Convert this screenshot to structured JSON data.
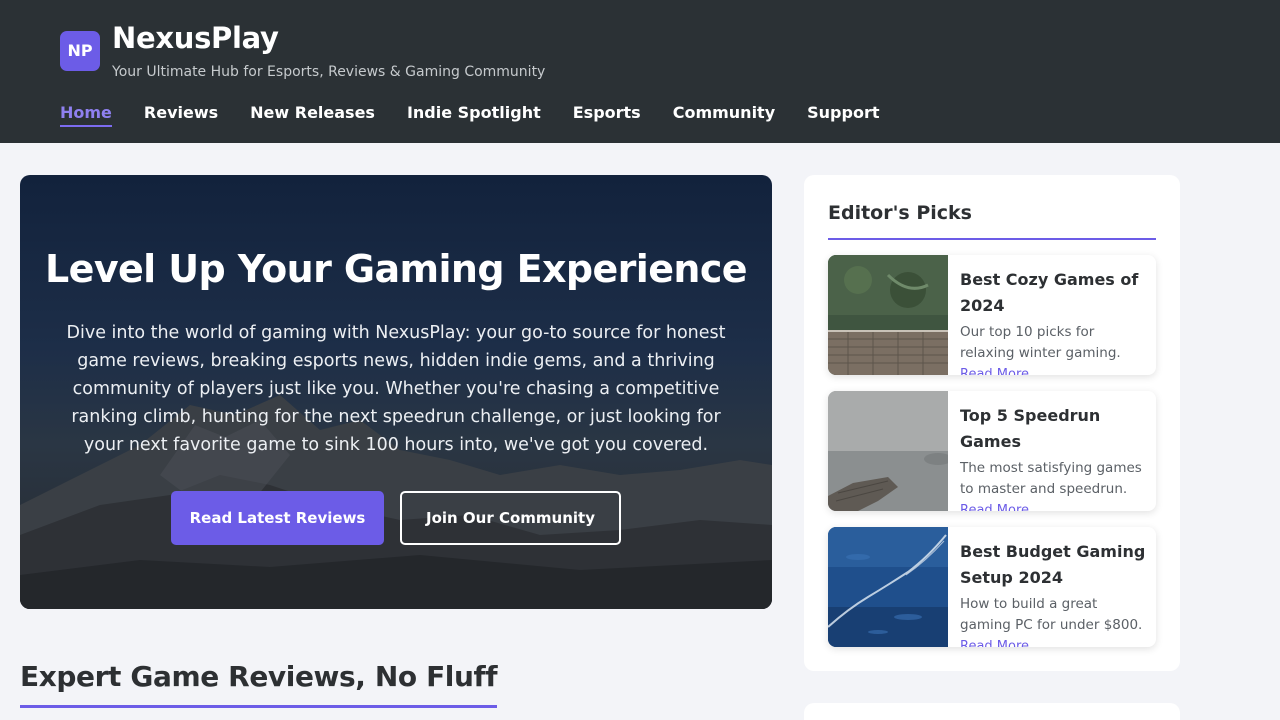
{
  "site": {
    "logo_text": "NP",
    "name": "NexusPlay",
    "tagline": "Your Ultimate Hub for Esports, Reviews & Gaming Community"
  },
  "nav": {
    "items": [
      {
        "label": "Home",
        "active": true
      },
      {
        "label": "Reviews"
      },
      {
        "label": "New Releases"
      },
      {
        "label": "Indie Spotlight"
      },
      {
        "label": "Esports"
      },
      {
        "label": "Community"
      },
      {
        "label": "Support"
      }
    ]
  },
  "hero": {
    "title": "Level Up Your Gaming Experience",
    "text": "Dive into the world of gaming with NexusPlay: your go-to source for honest game reviews, breaking esports news, hidden indie gems, and a thriving community of players just like you. Whether you're chasing a competitive ranking climb, hunting for the next speedrun challenge, or just looking for your next favorite game to sink 100 hours into, we've got you covered.",
    "primary_button": "Read Latest Reviews",
    "secondary_button": "Join Our Community"
  },
  "section": {
    "title": "Expert Game Reviews, No Fluff"
  },
  "editors_picks": {
    "title": "Editor's Picks",
    "items": [
      {
        "title": "Best Cozy Games of 2024",
        "desc": "Our top 10 picks for relaxing winter gaming.",
        "more": "Read More"
      },
      {
        "title": "Top 5 Speedrun Games",
        "desc": "The most satisfying games to master and speedrun.",
        "more": "Read More"
      },
      {
        "title": "Best Budget Gaming Setup 2024",
        "desc": "How to build a great gaming PC for under $800.",
        "more": "Read More"
      }
    ]
  },
  "colors": {
    "header_bg": "#2b3135",
    "accent": "#6c5ce7",
    "page_bg": "#f3f4f8"
  }
}
